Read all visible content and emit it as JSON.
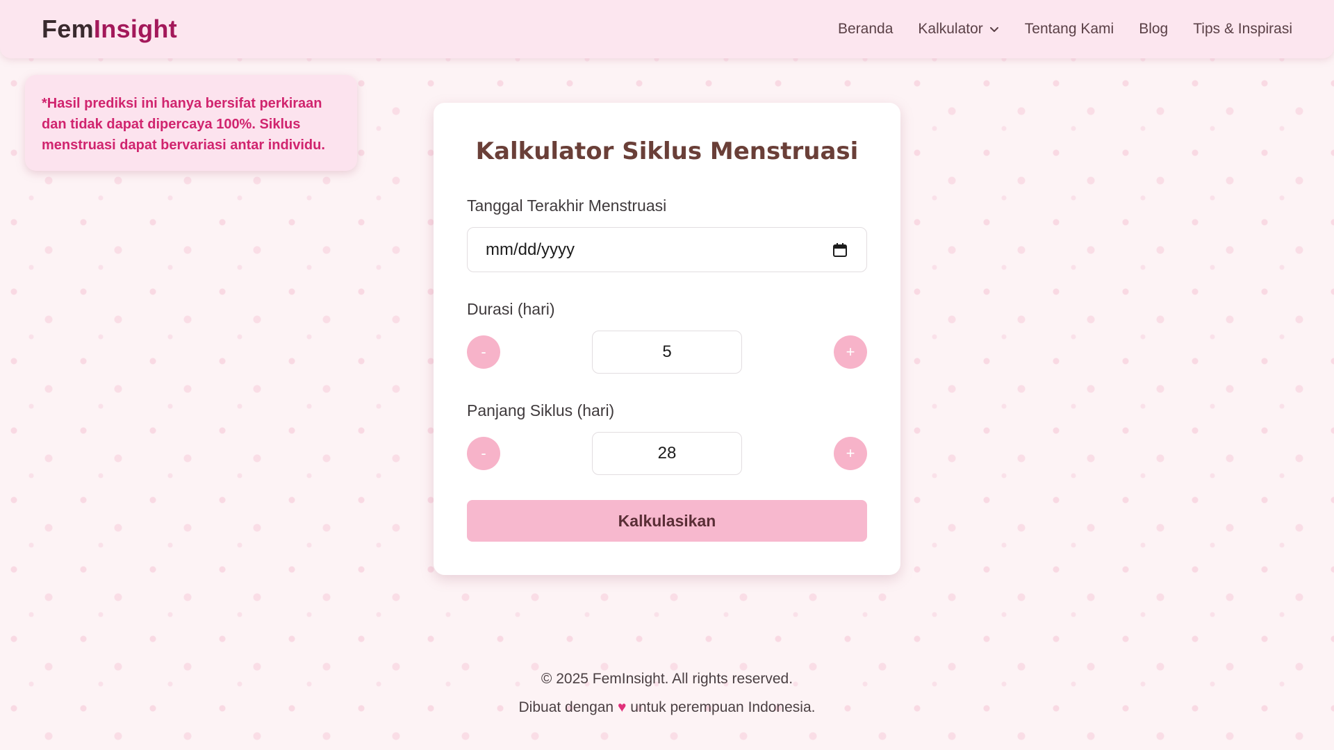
{
  "brand": {
    "part1": "Fem",
    "part2": "Insight"
  },
  "nav": {
    "items": [
      {
        "label": "Beranda"
      },
      {
        "label": "Kalkulator"
      },
      {
        "label": "Tentang Kami"
      },
      {
        "label": "Blog"
      },
      {
        "label": "Tips & Inspirasi"
      }
    ]
  },
  "disclaimer": "*Hasil prediksi ini hanya bersifat perkiraan dan tidak dapat dipercaya 100%. Siklus menstruasi dapat bervariasi antar individu.",
  "calculator": {
    "title": "Kalkulator Siklus Menstruasi",
    "last_period_label": "Tanggal Terakhir Menstruasi",
    "last_period_placeholder": "mm/dd/yyyy",
    "duration_label": "Durasi (hari)",
    "duration_value": "5",
    "cycle_label": "Panjang Siklus (hari)",
    "cycle_value": "28",
    "minus_label": "-",
    "plus_label": "+",
    "submit_label": "Kalkulasikan"
  },
  "footer": {
    "copyright": "© 2025 FemInsight. All rights reserved.",
    "made_prefix": "Dibuat dengan",
    "heart": "♥",
    "made_suffix": "untuk perempuan Indonesia."
  },
  "colors": {
    "accent_pink": "#f7b3c9",
    "brand_magenta": "#a3185a",
    "disclaimer_text": "#d0246e",
    "title_brown": "#6a3f38"
  },
  "icons": [
    "chevron-down-icon",
    "calendar-icon",
    "heart-icon"
  ]
}
